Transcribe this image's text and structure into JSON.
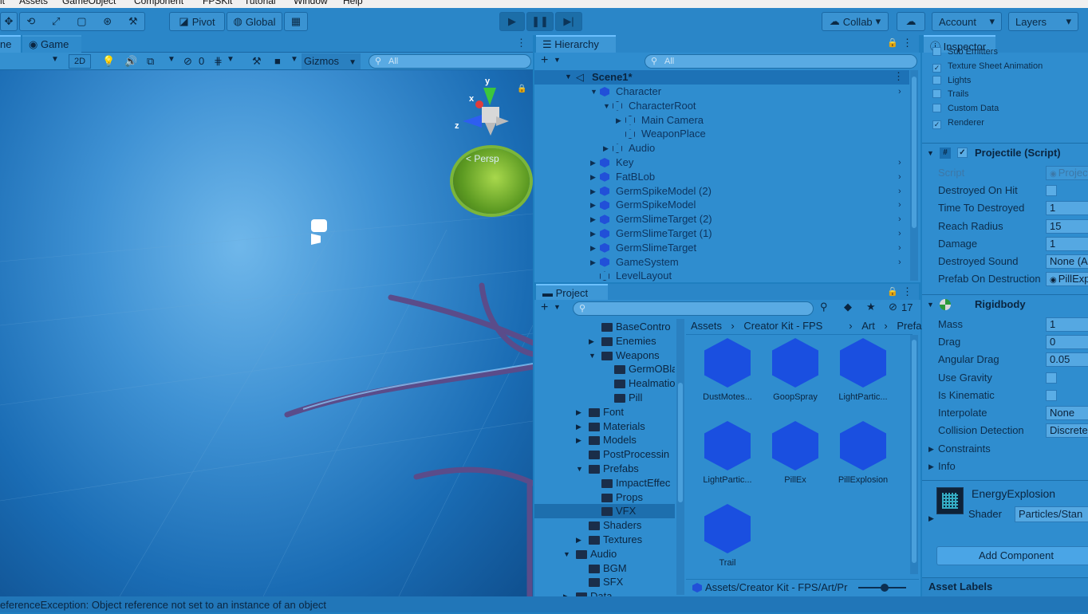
{
  "menubar": [
    "it",
    "Assets",
    "GameObject",
    "Component",
    "FPSKit",
    "Tutorial",
    "Window",
    "Help"
  ],
  "toolbar": {
    "pivot": "Pivot",
    "global": "Global",
    "collab": "Collab",
    "account": "Account",
    "layers": "Layers"
  },
  "scene": {
    "tab_scene": "ne",
    "tab_game": "Game",
    "btn_2d": "2D",
    "hidden_count": "0",
    "gizmos": "Gizmos",
    "search_placeholder": "All",
    "persp": "< Persp",
    "axis_x": "x",
    "axis_y": "y",
    "axis_z": "z"
  },
  "hierarchy": {
    "title": "Hierarchy",
    "search_placeholder": "All",
    "scene_name": "Scene1*",
    "items": [
      {
        "label": "Character",
        "depth": 1,
        "icon": "cube-blue",
        "expanded": true,
        "has_arrow_right": true
      },
      {
        "label": "CharacterRoot",
        "depth": 2,
        "icon": "cube-outline",
        "expanded": true
      },
      {
        "label": "Main Camera",
        "depth": 3,
        "icon": "cube-outline",
        "expanded": false
      },
      {
        "label": "WeaponPlace",
        "depth": 3,
        "icon": "cube-outline",
        "leaf": true
      },
      {
        "label": "Audio",
        "depth": 2,
        "icon": "cube-outline",
        "expanded": false
      },
      {
        "label": "Key",
        "depth": 1,
        "icon": "cube-blue",
        "expanded": false,
        "has_arrow_right": true
      },
      {
        "label": "FatBLob",
        "depth": 1,
        "icon": "cube-blue",
        "expanded": false,
        "has_arrow_right": true
      },
      {
        "label": "GermSpikeModel (2)",
        "depth": 1,
        "icon": "cube-blue",
        "expanded": false,
        "has_arrow_right": true
      },
      {
        "label": "GermSpikeModel",
        "depth": 1,
        "icon": "cube-blue",
        "expanded": false,
        "has_arrow_right": true
      },
      {
        "label": "GermSlimeTarget (2)",
        "depth": 1,
        "icon": "cube-blue",
        "expanded": false,
        "has_arrow_right": true
      },
      {
        "label": "GermSlimeTarget (1)",
        "depth": 1,
        "icon": "cube-blue",
        "expanded": false,
        "has_arrow_right": true
      },
      {
        "label": "GermSlimeTarget",
        "depth": 1,
        "icon": "cube-blue",
        "expanded": false,
        "has_arrow_right": true
      },
      {
        "label": "GameSystem",
        "depth": 1,
        "icon": "cube-blue",
        "expanded": false,
        "has_arrow_right": true
      },
      {
        "label": "LevelLayout",
        "depth": 1,
        "icon": "cube-outline",
        "leaf": true
      }
    ]
  },
  "project": {
    "title": "Project",
    "hidden_count": "17",
    "breadcrumb": [
      "Assets",
      "Creator Kit - FPS",
      "Art",
      "Prefabs"
    ],
    "tree": [
      {
        "label": "BaseContro",
        "depth": 3,
        "arrow": ""
      },
      {
        "label": "Enemies",
        "depth": 3,
        "arrow": "right"
      },
      {
        "label": "Weapons",
        "depth": 3,
        "arrow": "down"
      },
      {
        "label": "GermOBla",
        "depth": 4,
        "arrow": ""
      },
      {
        "label": "Healmatio",
        "depth": 4,
        "arrow": ""
      },
      {
        "label": "Pill",
        "depth": 4,
        "arrow": ""
      },
      {
        "label": "Font",
        "depth": 2,
        "arrow": "right"
      },
      {
        "label": "Materials",
        "depth": 2,
        "arrow": "right"
      },
      {
        "label": "Models",
        "depth": 2,
        "arrow": "right"
      },
      {
        "label": "PostProcessin",
        "depth": 2,
        "arrow": ""
      },
      {
        "label": "Prefabs",
        "depth": 2,
        "arrow": "down"
      },
      {
        "label": "ImpactEffec",
        "depth": 3,
        "arrow": ""
      },
      {
        "label": "Props",
        "depth": 3,
        "arrow": ""
      },
      {
        "label": "VFX",
        "depth": 3,
        "arrow": "",
        "selected": true
      },
      {
        "label": "Shaders",
        "depth": 2,
        "arrow": ""
      },
      {
        "label": "Textures",
        "depth": 2,
        "arrow": "right"
      },
      {
        "label": "Audio",
        "depth": 1,
        "arrow": "down"
      },
      {
        "label": "BGM",
        "depth": 2,
        "arrow": ""
      },
      {
        "label": "SFX",
        "depth": 2,
        "arrow": ""
      },
      {
        "label": "Data",
        "depth": 1,
        "arrow": "right"
      }
    ],
    "assets": [
      "DustMotes...",
      "GoopSpray",
      "LightPartic...",
      "LightPartic...",
      "PillEx",
      "PillExplosion",
      "Trail"
    ],
    "path": "Assets/Creator Kit - FPS/Art/Pr"
  },
  "inspector": {
    "title": "Inspector",
    "modules": [
      {
        "label": "Sub Emitters",
        "checked": false
      },
      {
        "label": "Texture Sheet Animation",
        "checked": true
      },
      {
        "label": "Lights",
        "checked": false
      },
      {
        "label": "Trails",
        "checked": false
      },
      {
        "label": "Custom Data",
        "checked": false
      },
      {
        "label": "Renderer",
        "checked": true
      }
    ],
    "projectile": {
      "title": "Projectile (Script)",
      "fields": [
        {
          "label": "Script",
          "value": "Projec",
          "type": "object"
        },
        {
          "label": "Destroyed On Hit",
          "value": "",
          "type": "check"
        },
        {
          "label": "Time To Destroyed",
          "value": "1",
          "type": "text"
        },
        {
          "label": "Reach Radius",
          "value": "15",
          "type": "text"
        },
        {
          "label": "Damage",
          "value": "1",
          "type": "text"
        },
        {
          "label": "Destroyed Sound",
          "value": "None (A",
          "type": "text"
        },
        {
          "label": "Prefab On Destruction",
          "value": "PillExp",
          "type": "object"
        }
      ]
    },
    "rigidbody": {
      "title": "Rigidbody",
      "fields": [
        {
          "label": "Mass",
          "value": "1",
          "type": "text"
        },
        {
          "label": "Drag",
          "value": "0",
          "type": "text"
        },
        {
          "label": "Angular Drag",
          "value": "0.05",
          "type": "text"
        },
        {
          "label": "Use Gravity",
          "value": "",
          "type": "check"
        },
        {
          "label": "Is Kinematic",
          "value": "",
          "type": "check"
        },
        {
          "label": "Interpolate",
          "value": "None",
          "type": "text"
        },
        {
          "label": "Collision Detection",
          "value": "Discrete",
          "type": "text"
        }
      ],
      "foldouts": [
        "Constraints",
        "Info"
      ]
    },
    "material": {
      "name": "EnergyExplosion",
      "shader_label": "Shader",
      "shader": "Particles/Stan"
    },
    "add_component": "Add Component",
    "asset_labels": "Asset Labels"
  },
  "status": {
    "message": "eferenceException: Object reference not set to an instance of an object"
  }
}
